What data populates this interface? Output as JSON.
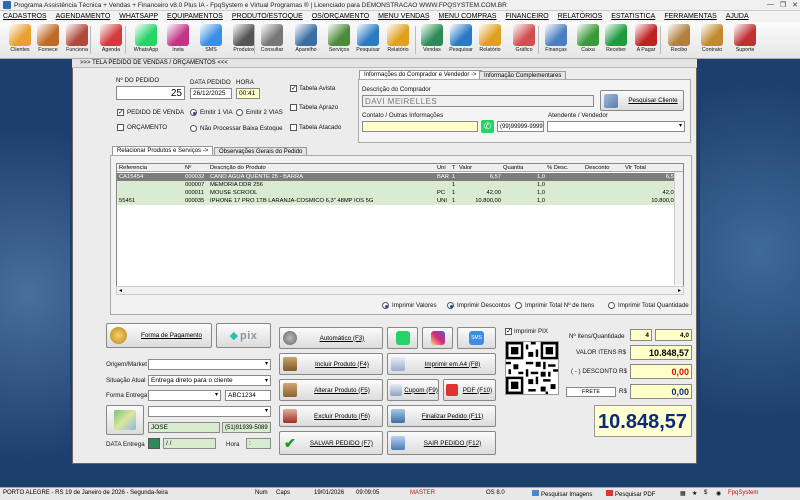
{
  "window": {
    "title": "Programa Assistência Técnica + Vendas + Financeiro v8.0 Plus IA - FpqSystem e Virtual Programas ® | Licenciado para  DEMONSTRACAO WWW.FPQSYSTEM.COM.BR",
    "minimize": "—",
    "maximize": "❐",
    "close": "✕"
  },
  "menu": [
    "CADASTROS",
    "AGENDAMENTO",
    "WHATSAPP",
    "EQUIPAMENTOS",
    "PRODUTO/ESTOQUE",
    "OS/ORÇAMENTO",
    "MENU VENDAS",
    "MENU COMPRAS",
    "FINANCEIRO",
    "RELATÓRIOS",
    "ESTATISTICA",
    "FERRAMENTAS",
    "AJUDA"
  ],
  "toolbar": [
    {
      "label": "Clientes",
      "icon": "clients-icon",
      "color": "#e8a030"
    },
    {
      "label": "Fornece",
      "icon": "supplier-icon",
      "color": "#c06a2a"
    },
    {
      "label": "Funciona",
      "icon": "employee-icon",
      "color": "#b04a3a"
    },
    {
      "label": "Agenda",
      "icon": "calendar-icon",
      "color": "#d23b3b"
    },
    {
      "label": "WhatsApp",
      "icon": "whatsapp-icon",
      "color": "#25d366"
    },
    {
      "label": "Insta",
      "icon": "instagram-icon",
      "color": "#c13584"
    },
    {
      "label": "SMS",
      "icon": "sms-icon",
      "color": "#3a8ee6"
    },
    {
      "label": "Produtos",
      "icon": "products-icon",
      "color": "#555555"
    },
    {
      "label": "Consultar",
      "icon": "consult-icon",
      "color": "#777777"
    },
    {
      "label": "Aparelho",
      "icon": "device-icon",
      "color": "#3a6ea5"
    },
    {
      "label": "Serviços",
      "icon": "services-icon",
      "color": "#4b8b3b"
    },
    {
      "label": "Pesquisar",
      "icon": "search-icon",
      "color": "#2a7bc4"
    },
    {
      "label": "Relatório",
      "icon": "report-icon",
      "color": "#e0a020"
    },
    {
      "label": "Vendas",
      "icon": "sales-icon",
      "color": "#2e8b57"
    },
    {
      "label": "Pesquisar",
      "icon": "search-icon",
      "color": "#2a7bc4"
    },
    {
      "label": "Relatório",
      "icon": "report-icon",
      "color": "#e0a020"
    },
    {
      "label": "Gráfico",
      "icon": "chart-icon",
      "color": "#d05050"
    },
    {
      "label": "Finanças",
      "icon": "finance-icon",
      "color": "#4a7fc0"
    },
    {
      "label": "Caixa",
      "icon": "cash-icon",
      "color": "#3a9a3a"
    },
    {
      "label": "Receber",
      "icon": "receive-icon",
      "color": "#1f9a3f"
    },
    {
      "label": "A Pagar",
      "icon": "pay-icon",
      "color": "#c02020"
    },
    {
      "label": "Recibo",
      "icon": "receipt-icon",
      "color": "#b08040"
    },
    {
      "label": "Contrato",
      "icon": "contract-icon",
      "color": "#c08a30"
    },
    {
      "label": "Suporte",
      "icon": "support-icon",
      "color": "#c03030"
    }
  ],
  "panel_title": ">>>  TELA PEDIDO DE VENDAS / ORÇAMENTOS  <<<",
  "order": {
    "numero_label": "Nº DO PEDIDO",
    "numero": "25",
    "data_label": "DATA PEDIDO",
    "data": "26/12/2025",
    "hora_label": "HORA",
    "hora": "00:41",
    "pedido_venda": "PEDIDO DE VENDA",
    "orcamento": "ORÇAMENTO",
    "emitir1": "Emitir 1 VIA",
    "emitir2": "Emitir 2 VIAS",
    "nao_processar": "Não Processar Baixa Estoque",
    "tabela_avista": "Tabela Avista",
    "tabela_aprazo": "Tabela Aprazo",
    "tabela_atacado": "Tabela Atacado"
  },
  "buyer": {
    "tab1": "Informações do Comprador e Vendedor ->",
    "tab2": "Informação Complementares",
    "descricao_label": "Descrição do Comprador",
    "descricao": "DAVI MEIRELLES",
    "pesquisar": "Pesquisar Cliente",
    "contato_label": "Contato / Outras Informações",
    "telefone": "(99)99999-9999",
    "atendente_label": "Atendente / Vendedor"
  },
  "items_tabs": [
    "Relacionar Produtos e Serviços ->",
    "Observações Gerais do Pedido"
  ],
  "grid": {
    "headers": [
      "Referencia",
      "Nº",
      "Descrição do Produto",
      "Uni",
      "T",
      "Valor",
      "Quantia",
      "% Desc.",
      "Desconto",
      "Vlr Total"
    ],
    "rows": [
      [
        "CA15454",
        "000032",
        "CANO AGUA QUENTE 25 - BARRA",
        "BAR",
        "1",
        "6,57",
        "1,0",
        "",
        "",
        "6,57"
      ],
      [
        "",
        "000007",
        "MEMORIA DDR 256",
        "",
        "1",
        "",
        "1,0",
        "",
        "",
        ""
      ],
      [
        "",
        "000011",
        "MOUSE SCROOL",
        "PC",
        "1",
        "42,00",
        "1,0",
        "",
        "",
        "42,00"
      ],
      [
        "55451",
        "000035",
        "IPHONE 17 PRO 1TB LARANJA-COSMICO 6,3\" 48MP IOS 5G",
        "UNI",
        "1",
        "10.800,00",
        "1,0",
        "",
        "",
        "10.800,00"
      ]
    ]
  },
  "print_options": [
    "Imprimir Valores",
    "Imprimir Descontos",
    "Imprimir Total Nº de Itens",
    "Imprimir Total Quantidade"
  ],
  "actions": {
    "forma_pagamento": "Forma de Pagamento",
    "pix": "PIX",
    "automatico": "Automático    (F3)",
    "incluir": "Incluir Produto  (F4)",
    "alterar": "Alterar Produto  (F5)",
    "excluir": "Excluir Produto  (F6)",
    "salvar": "SALVAR PEDIDO (F7)",
    "imprimir_a4": "Imprimir em A4  (F8)",
    "cupom": "Cupom (F9)",
    "pdf": "PDF (F10)",
    "finalizar": "Finalizar Pedido  (F11)",
    "sair": "SAIR  PEDIDO  (F12)",
    "sms": "SMS"
  },
  "origin": {
    "origem_label": "Origem/Market",
    "situacao_label": "Situação Atual",
    "situacao": "Entrega direto para o cliente",
    "forma_entrega_label": "Forma Entrega",
    "codigo": "ABC1234",
    "endereco": "JOSE",
    "telefone": "(51)91939-5089",
    "data_entrega_label": "DATA Entrega",
    "data_entrega": "  /  /",
    "hora_label": "Hora",
    "hora": "  :"
  },
  "totals": {
    "imprimir_pix": "Imprimir PIX",
    "itens_label": "Nº Itens/Quantidade",
    "itens": "4",
    "quantidade": "4,0",
    "valor_itens_label": "VALOR ITENS R$",
    "valor_itens": "10.848,57",
    "desconto_label": "( - ) DESCONTO R$",
    "desconto": "0,00",
    "frete_label": "FRETE",
    "frete_rs": "R$",
    "frete": "0,00",
    "total": "10.848,57"
  },
  "status": {
    "city": "PORTO ALEGRE - RS 19 de Janeiro de 2026 - Segunda-feira",
    "num": "Num",
    "caps": "Caps",
    "date": "19/01/2026",
    "time": "09:09:05",
    "master": "MASTER",
    "os": "OS 8.0",
    "search_images": "Pesquisar Imagens",
    "search_pdf": "Pesquisar PDF",
    "brand": "FpqSystem"
  }
}
